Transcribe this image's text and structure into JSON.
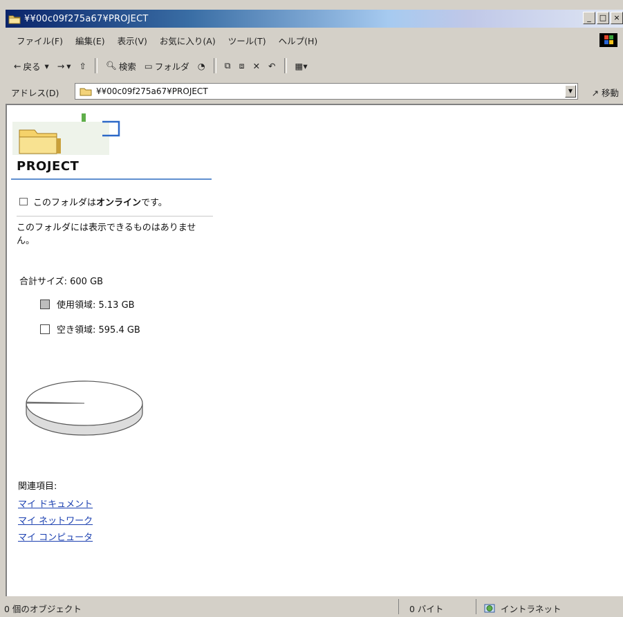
{
  "window": {
    "title": "¥¥00c09f275a67¥PROJECT",
    "buttons": {
      "minimize": "_",
      "maximize": "□",
      "close": "×"
    }
  },
  "menu": [
    "ファイル(F)",
    "編集(E)",
    "表示(V)",
    "お気に入り(A)",
    "ツール(T)",
    "ヘルプ(H)"
  ],
  "toolbar": {
    "back": "戻る",
    "search": "検索",
    "folders": "フォルダ"
  },
  "address": {
    "label": "アドレス(D)",
    "value": "¥¥00c09f275a67¥PROJECT",
    "go": "移動"
  },
  "panel": {
    "folder_name": "PROJECT",
    "online_prefix": "このフォルダは",
    "online_bold": "オンライン",
    "online_suffix": "です。",
    "empty_message": "このフォルダには表示できるものはありません。",
    "total_size": "合計サイズ: 600 GB",
    "used": "使用領域: 5.13 GB",
    "free": "空き領域: 595.4 GB",
    "related_heading": "関連項目:",
    "links": [
      "マイ ドキュメント",
      "マイ ネットワーク",
      "マイ コンピュータ"
    ]
  },
  "usage": {
    "used_gb": 5.13,
    "free_gb": 595.4
  },
  "status": {
    "objects": "0 個のオブジェクト",
    "size": "0 バイト",
    "zone": "イントラネット"
  },
  "colors": {
    "title_start": "#0a246a",
    "link": "#1a3fb0",
    "rule": "#5f8fd0",
    "pie_used": "#bdbdbd",
    "pie_free": "#ffffff"
  }
}
